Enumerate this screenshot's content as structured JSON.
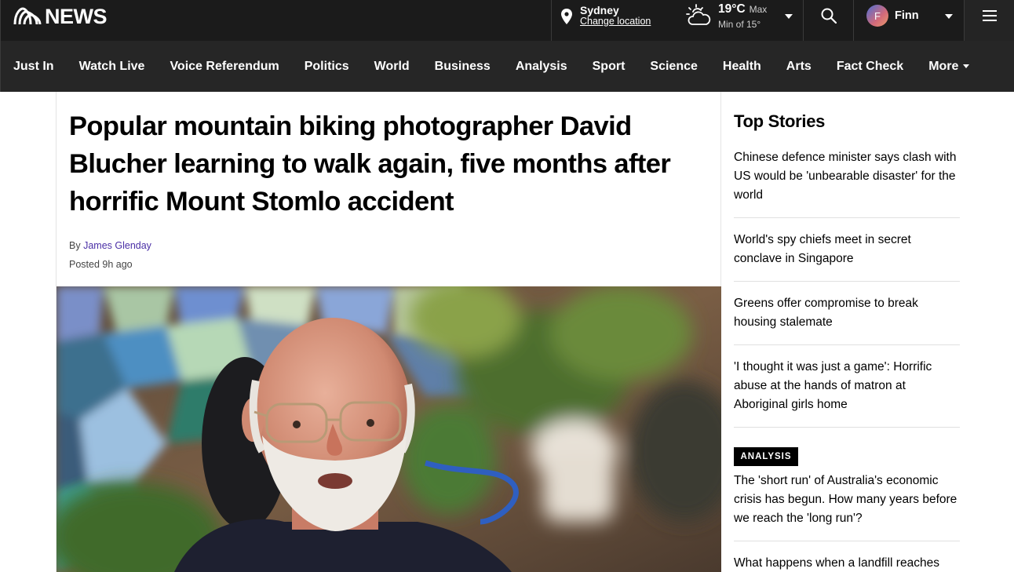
{
  "header": {
    "logo_text": "NEWS",
    "location": {
      "city": "Sydney",
      "change_label": "Change location"
    },
    "weather": {
      "temp": "19°C",
      "max_label": "Max",
      "min_label": "Min of 15°"
    },
    "user": {
      "initial": "F",
      "name": "Finn"
    }
  },
  "nav": {
    "items": [
      "Just In",
      "Watch Live",
      "Voice Referendum",
      "Politics",
      "World",
      "Business",
      "Analysis",
      "Sport",
      "Science",
      "Health",
      "Arts",
      "Fact Check"
    ],
    "more_label": "More"
  },
  "article": {
    "headline": "Popular mountain biking photographer David Blucher learning to walk again, five months after horrific Mount Stomlo accident",
    "byline_prefix": "By",
    "author": "James Glenday",
    "posted": "Posted 9h ago"
  },
  "sidebar": {
    "title": "Top Stories",
    "stories": [
      "Chinese defence minister says clash with US would be 'unbearable disaster' for the world",
      "World's spy chiefs meet in secret conclave in Singapore",
      "Greens offer compromise to break housing stalemate",
      "'I thought it was just a game': Horrific abuse at the hands of matron at Aboriginal girls home",
      "The 'short run' of Australia's economic crisis has begun. How many years before we reach the 'long run'?",
      "What happens when a landfill reaches"
    ],
    "analysis_badge": "ANALYSIS"
  },
  "colors": {
    "topbar": "#1b1b1b",
    "navbar": "#262626",
    "author_link": "#4a2fa6"
  }
}
